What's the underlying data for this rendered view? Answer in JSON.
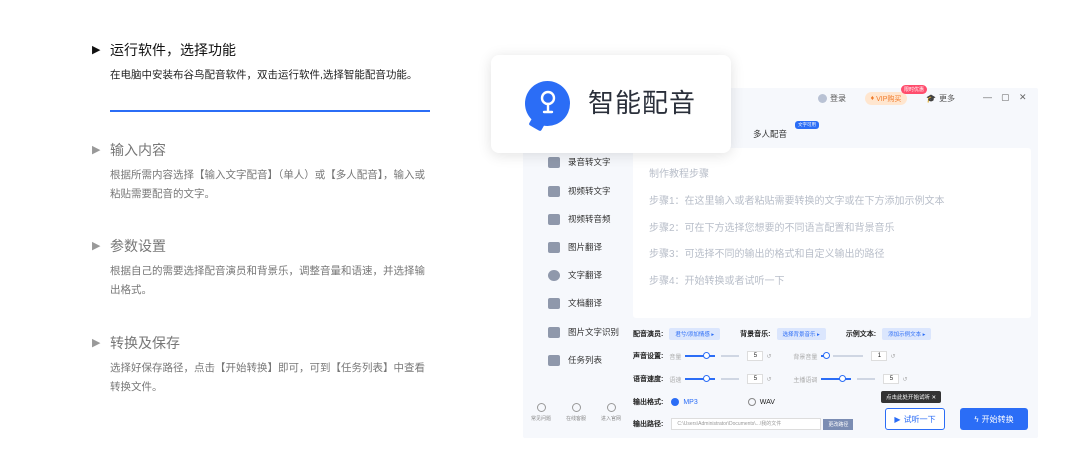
{
  "steps": [
    {
      "title": "运行软件，选择功能",
      "desc": "在电脑中安装布谷鸟配音软件，双击运行软件,选择智能配音功能。"
    },
    {
      "title": "输入内容",
      "desc": "根据所需内容选择【输入文字配音】（单人）或【多人配音】，输入或粘贴需要配音的文字。"
    },
    {
      "title": "参数设置",
      "desc": "根据自己的需要选择配音演员和背景乐，调整音量和语速，并选择输出格式。"
    },
    {
      "title": "转换及保存",
      "desc": "选择好保存路径，点击【开始转换】即可，可到【任务列表】中查看转换文件。"
    }
  ],
  "card": {
    "title": "智能配音"
  },
  "topbar": {
    "login": "登录",
    "vip": "VIP购买",
    "vip_badge": "限时优惠",
    "more": "更多",
    "min": "—",
    "max": "▢",
    "close": "✕"
  },
  "tabs": {
    "multi": "多人配音",
    "multi_badge": "文字可用"
  },
  "sidebar": [
    {
      "label": "录音转文字",
      "icon": "mic-chat-icon"
    },
    {
      "label": "视频转文字",
      "icon": "video-icon"
    },
    {
      "label": "视频转音频",
      "icon": "video-audio-icon"
    },
    {
      "label": "图片翻译",
      "icon": "image-icon"
    },
    {
      "label": "文字翻译",
      "icon": "translate-icon"
    },
    {
      "label": "文档翻译",
      "icon": "document-icon"
    },
    {
      "label": "图片文字识别",
      "icon": "ocr-icon"
    },
    {
      "label": "任务列表",
      "icon": "list-icon"
    }
  ],
  "bottom_icons": [
    {
      "label": "常见问题",
      "icon": "help-icon"
    },
    {
      "label": "在线客服",
      "icon": "service-icon"
    },
    {
      "label": "进入官网",
      "icon": "web-icon"
    }
  ],
  "textarea": {
    "title": "制作教程步骤",
    "lines": [
      "步骤1：在这里输入或者粘贴需要转换的文字或在下方添加示例文本",
      "步骤2：可在下方选择您想要的不同语言配置和背景音乐",
      "步骤3：可选择不同的输出的格式和自定义输出的路径",
      "步骤4：开始转换或者试听一下"
    ]
  },
  "controls": {
    "actor_label": "配音演员:",
    "actor_value": "君兮/添加情感 ▸",
    "bgm_label": "背景音乐:",
    "bgm_value": "选择背景音乐 ▸",
    "sample_label": "示例文本:",
    "sample_value": "添加示例文本 ▸",
    "vol_label": "声音设置:",
    "vol_sub": "音量",
    "vol_value": "5",
    "bgvol_sub": "背景音量",
    "bgvol_value": "1",
    "speed_label": "语音速度:",
    "speed_sub": "语速",
    "speed_value": "5",
    "pitch_sub": "主播语调",
    "pitch_value": "5",
    "format_label": "输出格式:",
    "format_mp3": "MP3",
    "format_wav": "WAV",
    "path_label": "输出路径:",
    "path_value": "C:\\Users\\Administrator\\Documents\\...\\我的文件",
    "path_btn": "更改路径",
    "reset": "↺"
  },
  "tip": "点击此处开始试听 ✕",
  "buttons": {
    "try": "试听一下",
    "start": "开始转换"
  }
}
